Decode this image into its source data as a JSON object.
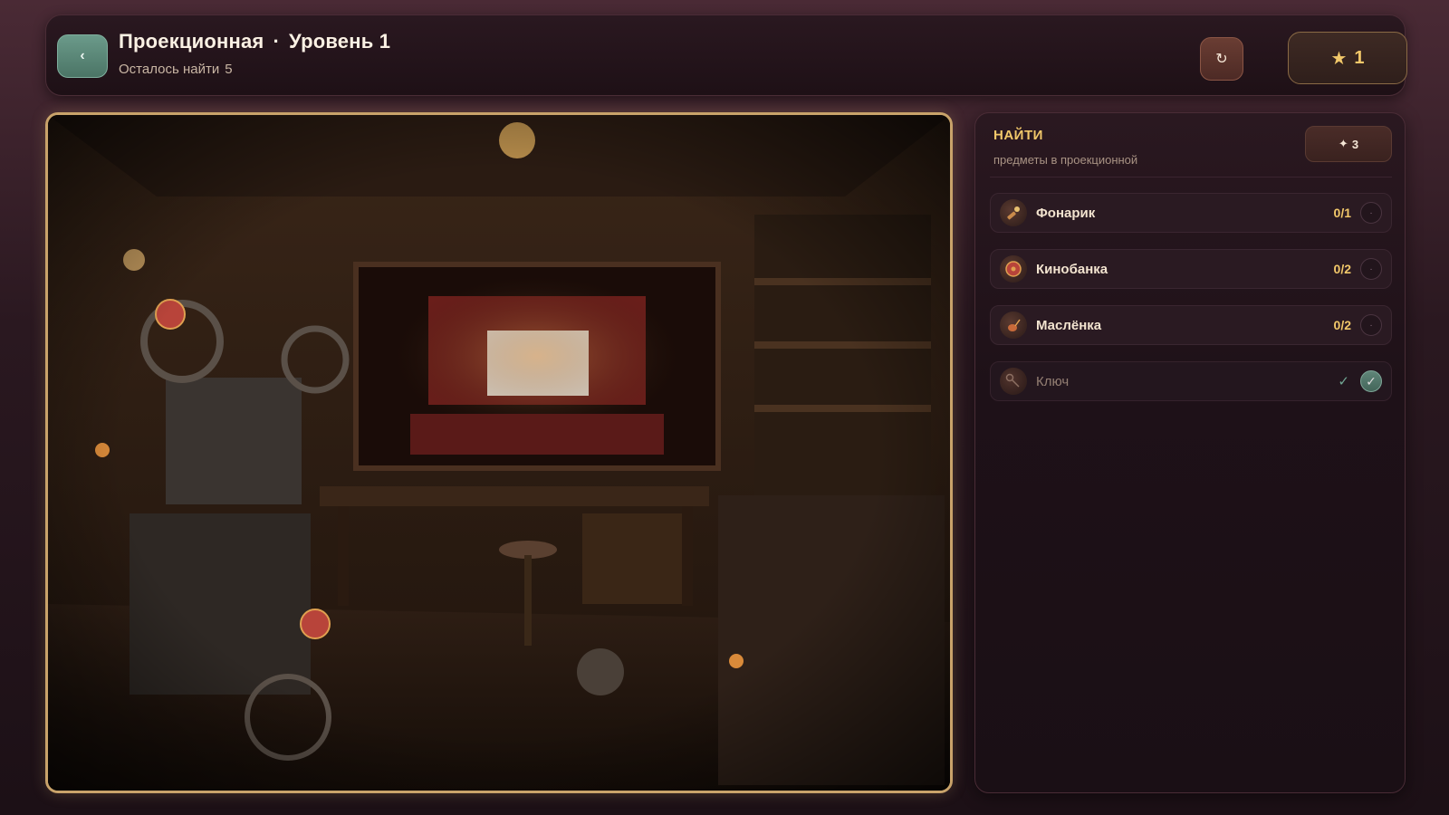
{
  "header": {
    "back_label": "‹",
    "location": "Проекционная",
    "separator": "·",
    "level": "Уровень 1",
    "remaining_label": "Осталось найти",
    "remaining_count": "5",
    "reset_label": "↻",
    "score_star": "★",
    "score_value": "1"
  },
  "panel": {
    "title": "НАЙТИ",
    "subtitle": "предметы в проекционной",
    "hint_icon": "✦",
    "hint_count": "3",
    "items": [
      {
        "name": "Фонарик",
        "progress": "0/1",
        "icon": "flashlight-icon",
        "state": "·"
      },
      {
        "name": "Кинобанка",
        "progress": "0/2",
        "icon": "film-can-icon",
        "state": "·"
      },
      {
        "name": "Маслёнка",
        "progress": "0/2",
        "icon": "oil-can-icon",
        "state": "·"
      },
      {
        "name": "Ключ",
        "check": "✓",
        "icon": "key-icon",
        "state": "✓"
      }
    ]
  },
  "colors": {
    "accent_gold": "#f2c86a",
    "frame_gold": "#c9a36a",
    "back_green": "#5f8b7c",
    "found_green": "#7fbfa8"
  }
}
